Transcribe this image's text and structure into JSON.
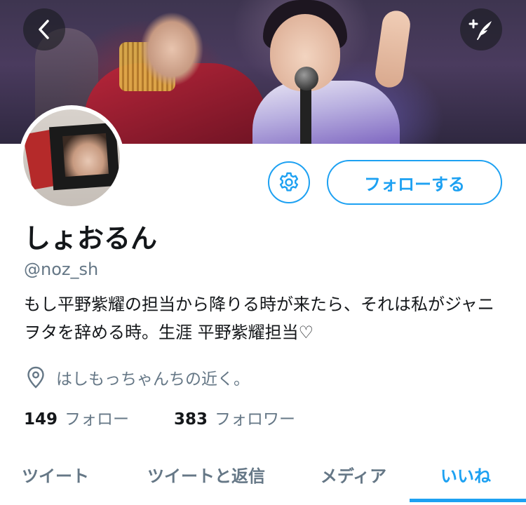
{
  "header": {
    "back_icon": "chevron-left-icon",
    "compose_icon": "compose-feather-icon"
  },
  "profile": {
    "display_name": "しょおるん",
    "handle": "@noz_sh",
    "bio": "もし平野紫耀の担当から降りる時が来たら、それは私がジャニヲタを辞める時。生涯 平野紫耀担当♡",
    "location": "はしもっちゃんちの近く。",
    "location_icon": "location-pin-icon",
    "settings_icon": "gear-icon",
    "follow_label": "フォローする"
  },
  "stats": {
    "following_count": "149",
    "following_label": "フォロー",
    "followers_count": "383",
    "followers_label": "フォロワー"
  },
  "tabs": [
    {
      "label": "ツイート",
      "active": false
    },
    {
      "label": "ツイートと返信",
      "active": false
    },
    {
      "label": "メディア",
      "active": false
    },
    {
      "label": "いいね",
      "active": true
    }
  ],
  "colors": {
    "accent": "#1da1f2",
    "text": "#14171a",
    "muted": "#657786"
  }
}
